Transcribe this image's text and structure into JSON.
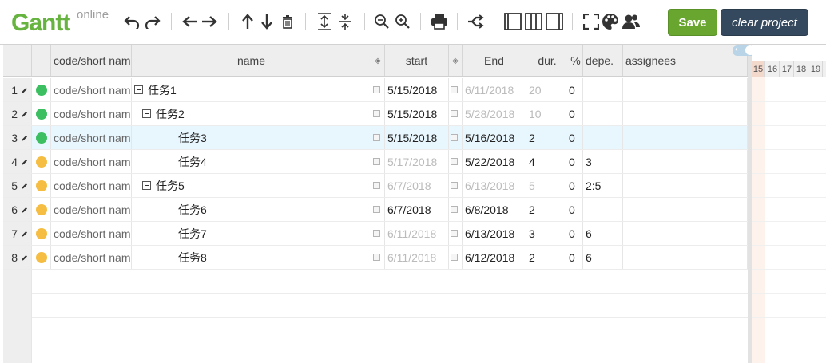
{
  "logo": {
    "main": "Gantt",
    "sub": "online"
  },
  "toolbar": {
    "icons": [
      "undo-icon",
      "redo-icon",
      "outdent-icon",
      "indent-icon",
      "move-up-icon",
      "move-down-icon",
      "delete-icon",
      "expand-all-icon",
      "collapse-all-icon",
      "zoom-out-icon",
      "zoom-in-icon",
      "print-icon",
      "critical-path-icon",
      "grid-only-icon",
      "split-view-icon",
      "gantt-only-icon",
      "fullscreen-icon",
      "palette-icon",
      "resources-icon"
    ],
    "save_label": "Save",
    "clear_label": "clear project"
  },
  "grid": {
    "headers": {
      "code": "code/short nam",
      "name": "name",
      "start": "start",
      "end": "End",
      "dur": "dur.",
      "pct": "%",
      "dep": "depe.",
      "assignees": "assignees"
    },
    "rows": [
      {
        "idx": "1",
        "status": "green",
        "code": "code/short nam",
        "name": "任务1",
        "level": 0,
        "toggle": true,
        "start": "5/15/2018",
        "start_dim": false,
        "end": "6/11/2018",
        "end_dim": true,
        "dur": "20",
        "dur_dim": true,
        "pct": "0",
        "dep": "",
        "selected": false
      },
      {
        "idx": "2",
        "status": "green",
        "code": "code/short nam",
        "name": "任务2",
        "level": 1,
        "toggle": true,
        "start": "5/15/2018",
        "start_dim": false,
        "end": "5/28/2018",
        "end_dim": true,
        "dur": "10",
        "dur_dim": true,
        "pct": "0",
        "dep": "",
        "selected": false
      },
      {
        "idx": "3",
        "status": "green",
        "code": "code/short nam",
        "name": "任务3",
        "level": 2,
        "toggle": false,
        "start": "5/15/2018",
        "start_dim": false,
        "end": "5/16/2018",
        "end_dim": false,
        "dur": "2",
        "dur_dim": false,
        "pct": "0",
        "dep": "",
        "selected": true
      },
      {
        "idx": "4",
        "status": "yellow",
        "code": "code/short nam",
        "name": "任务4",
        "level": 2,
        "toggle": false,
        "start": "5/17/2018",
        "start_dim": true,
        "end": "5/22/2018",
        "end_dim": false,
        "dur": "4",
        "dur_dim": false,
        "pct": "0",
        "dep": "3",
        "selected": false
      },
      {
        "idx": "5",
        "status": "yellow",
        "code": "code/short nam",
        "name": "任务5",
        "level": 1,
        "toggle": true,
        "start": "6/7/2018",
        "start_dim": true,
        "end": "6/13/2018",
        "end_dim": true,
        "dur": "5",
        "dur_dim": true,
        "pct": "0",
        "dep": "2:5",
        "selected": false
      },
      {
        "idx": "6",
        "status": "yellow",
        "code": "code/short nam",
        "name": "任务6",
        "level": 2,
        "toggle": false,
        "start": "6/7/2018",
        "start_dim": false,
        "end": "6/8/2018",
        "end_dim": false,
        "dur": "2",
        "dur_dim": false,
        "pct": "0",
        "dep": "",
        "selected": false
      },
      {
        "idx": "7",
        "status": "yellow",
        "code": "code/short nam",
        "name": "任务7",
        "level": 2,
        "toggle": false,
        "start": "6/11/2018",
        "start_dim": true,
        "end": "6/13/2018",
        "end_dim": false,
        "dur": "3",
        "dur_dim": false,
        "pct": "0",
        "dep": "6",
        "selected": false
      },
      {
        "idx": "8",
        "status": "yellow",
        "code": "code/short nam",
        "name": "任务8",
        "level": 2,
        "toggle": false,
        "start": "6/11/2018",
        "start_dim": true,
        "end": "6/12/2018",
        "end_dim": false,
        "dur": "2",
        "dur_dim": false,
        "pct": "0",
        "dep": "6",
        "selected": false
      }
    ]
  },
  "gantt": {
    "days": [
      "15",
      "16",
      "17",
      "18",
      "19"
    ],
    "today": "15"
  },
  "colors": {
    "green": "#3cbf61",
    "yellow": "#f5bd42",
    "accent": "#69a630",
    "dark": "#34495e"
  }
}
